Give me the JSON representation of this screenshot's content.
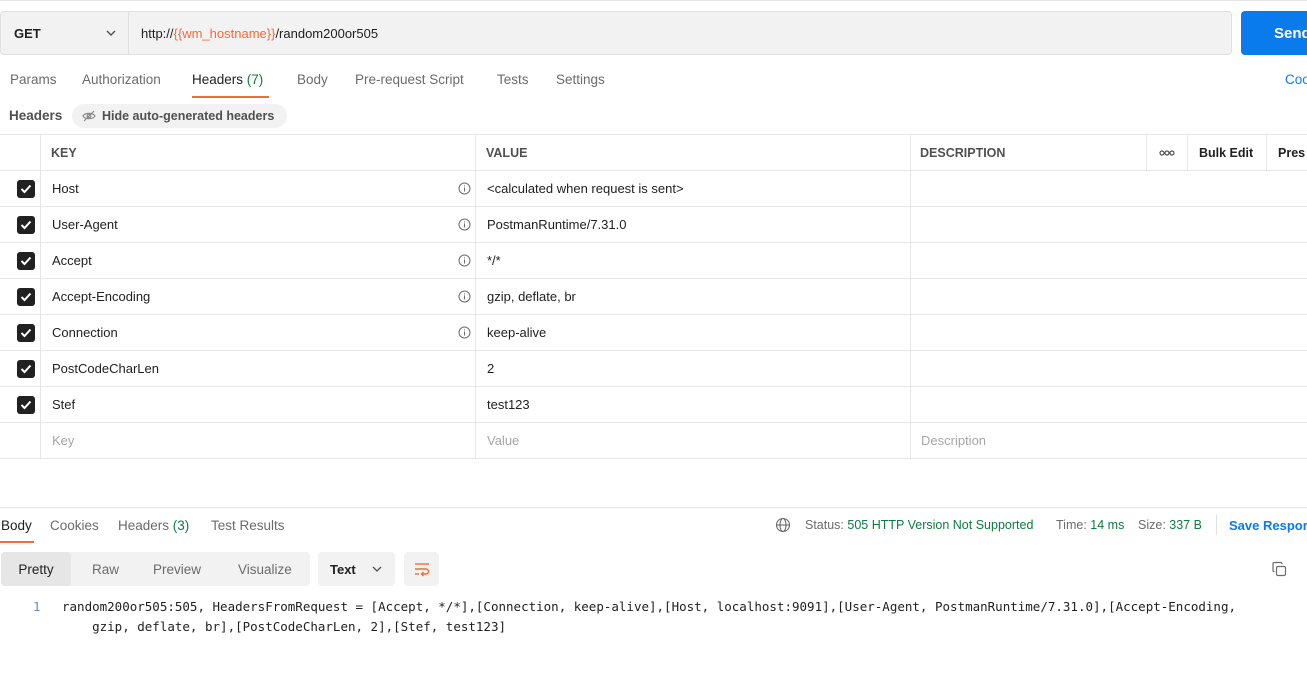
{
  "request": {
    "method": "GET",
    "url_prefix": "http://",
    "url_variable": "{{wm_hostname}}",
    "url_suffix": "/random200or505",
    "send_label": "Send"
  },
  "request_tabs": [
    {
      "label": "Params",
      "count": ""
    },
    {
      "label": "Authorization",
      "count": ""
    },
    {
      "label": "Headers",
      "count": "(7)"
    },
    {
      "label": "Body",
      "count": ""
    },
    {
      "label": "Pre-request Script",
      "count": ""
    },
    {
      "label": "Tests",
      "count": ""
    },
    {
      "label": "Settings",
      "count": ""
    }
  ],
  "code_link": "Coo",
  "headers_section": {
    "label": "Headers",
    "hide_button": "Hide auto-generated headers"
  },
  "table": {
    "columns": {
      "key": "KEY",
      "value": "VALUE",
      "description": "DESCRIPTION",
      "more": "ooo",
      "bulk_edit": "Bulk Edit",
      "presets": "Pres"
    },
    "rows": [
      {
        "key": "Host",
        "value": "<calculated when request is sent>",
        "checked": true,
        "auto": true
      },
      {
        "key": "User-Agent",
        "value": "PostmanRuntime/7.31.0",
        "checked": true,
        "auto": true
      },
      {
        "key": "Accept",
        "value": "*/*",
        "checked": true,
        "auto": true
      },
      {
        "key": "Accept-Encoding",
        "value": "gzip, deflate, br",
        "checked": true,
        "auto": true
      },
      {
        "key": "Connection",
        "value": "keep-alive",
        "checked": true,
        "auto": true
      },
      {
        "key": "PostCodeCharLen",
        "value": "2",
        "checked": true,
        "auto": false
      },
      {
        "key": "Stef",
        "value": "test123",
        "checked": true,
        "auto": false
      }
    ],
    "placeholder": {
      "key": "Key",
      "value": "Value",
      "description": "Description"
    }
  },
  "response": {
    "tabs": [
      {
        "label": "Body",
        "count": ""
      },
      {
        "label": "Cookies",
        "count": ""
      },
      {
        "label": "Headers",
        "count": "(3)"
      },
      {
        "label": "Test Results",
        "count": ""
      }
    ],
    "status_label": "Status:",
    "status_value": "505 HTTP Version Not Supported",
    "time_label": "Time:",
    "time_value": "14 ms",
    "size_label": "Size:",
    "size_value": "337 B",
    "save_label": "Save Respor",
    "views": [
      "Pretty",
      "Raw",
      "Preview",
      "Visualize"
    ],
    "format": "Text",
    "line_number": "1",
    "body_line1": "random200or505:505, HeadersFromRequest = [Accept, */*],[Connection, keep-alive],[Host, localhost:9091],[User-Agent, PostmanRuntime/7.31.0],[Accept-Encoding,",
    "body_line2": "    gzip, deflate, br],[PostCodeCharLen, 2],[Stef, test123]"
  },
  "colors": {
    "accent": "#f26b3a",
    "primary": "#097bed",
    "success": "#0f7b3f"
  }
}
